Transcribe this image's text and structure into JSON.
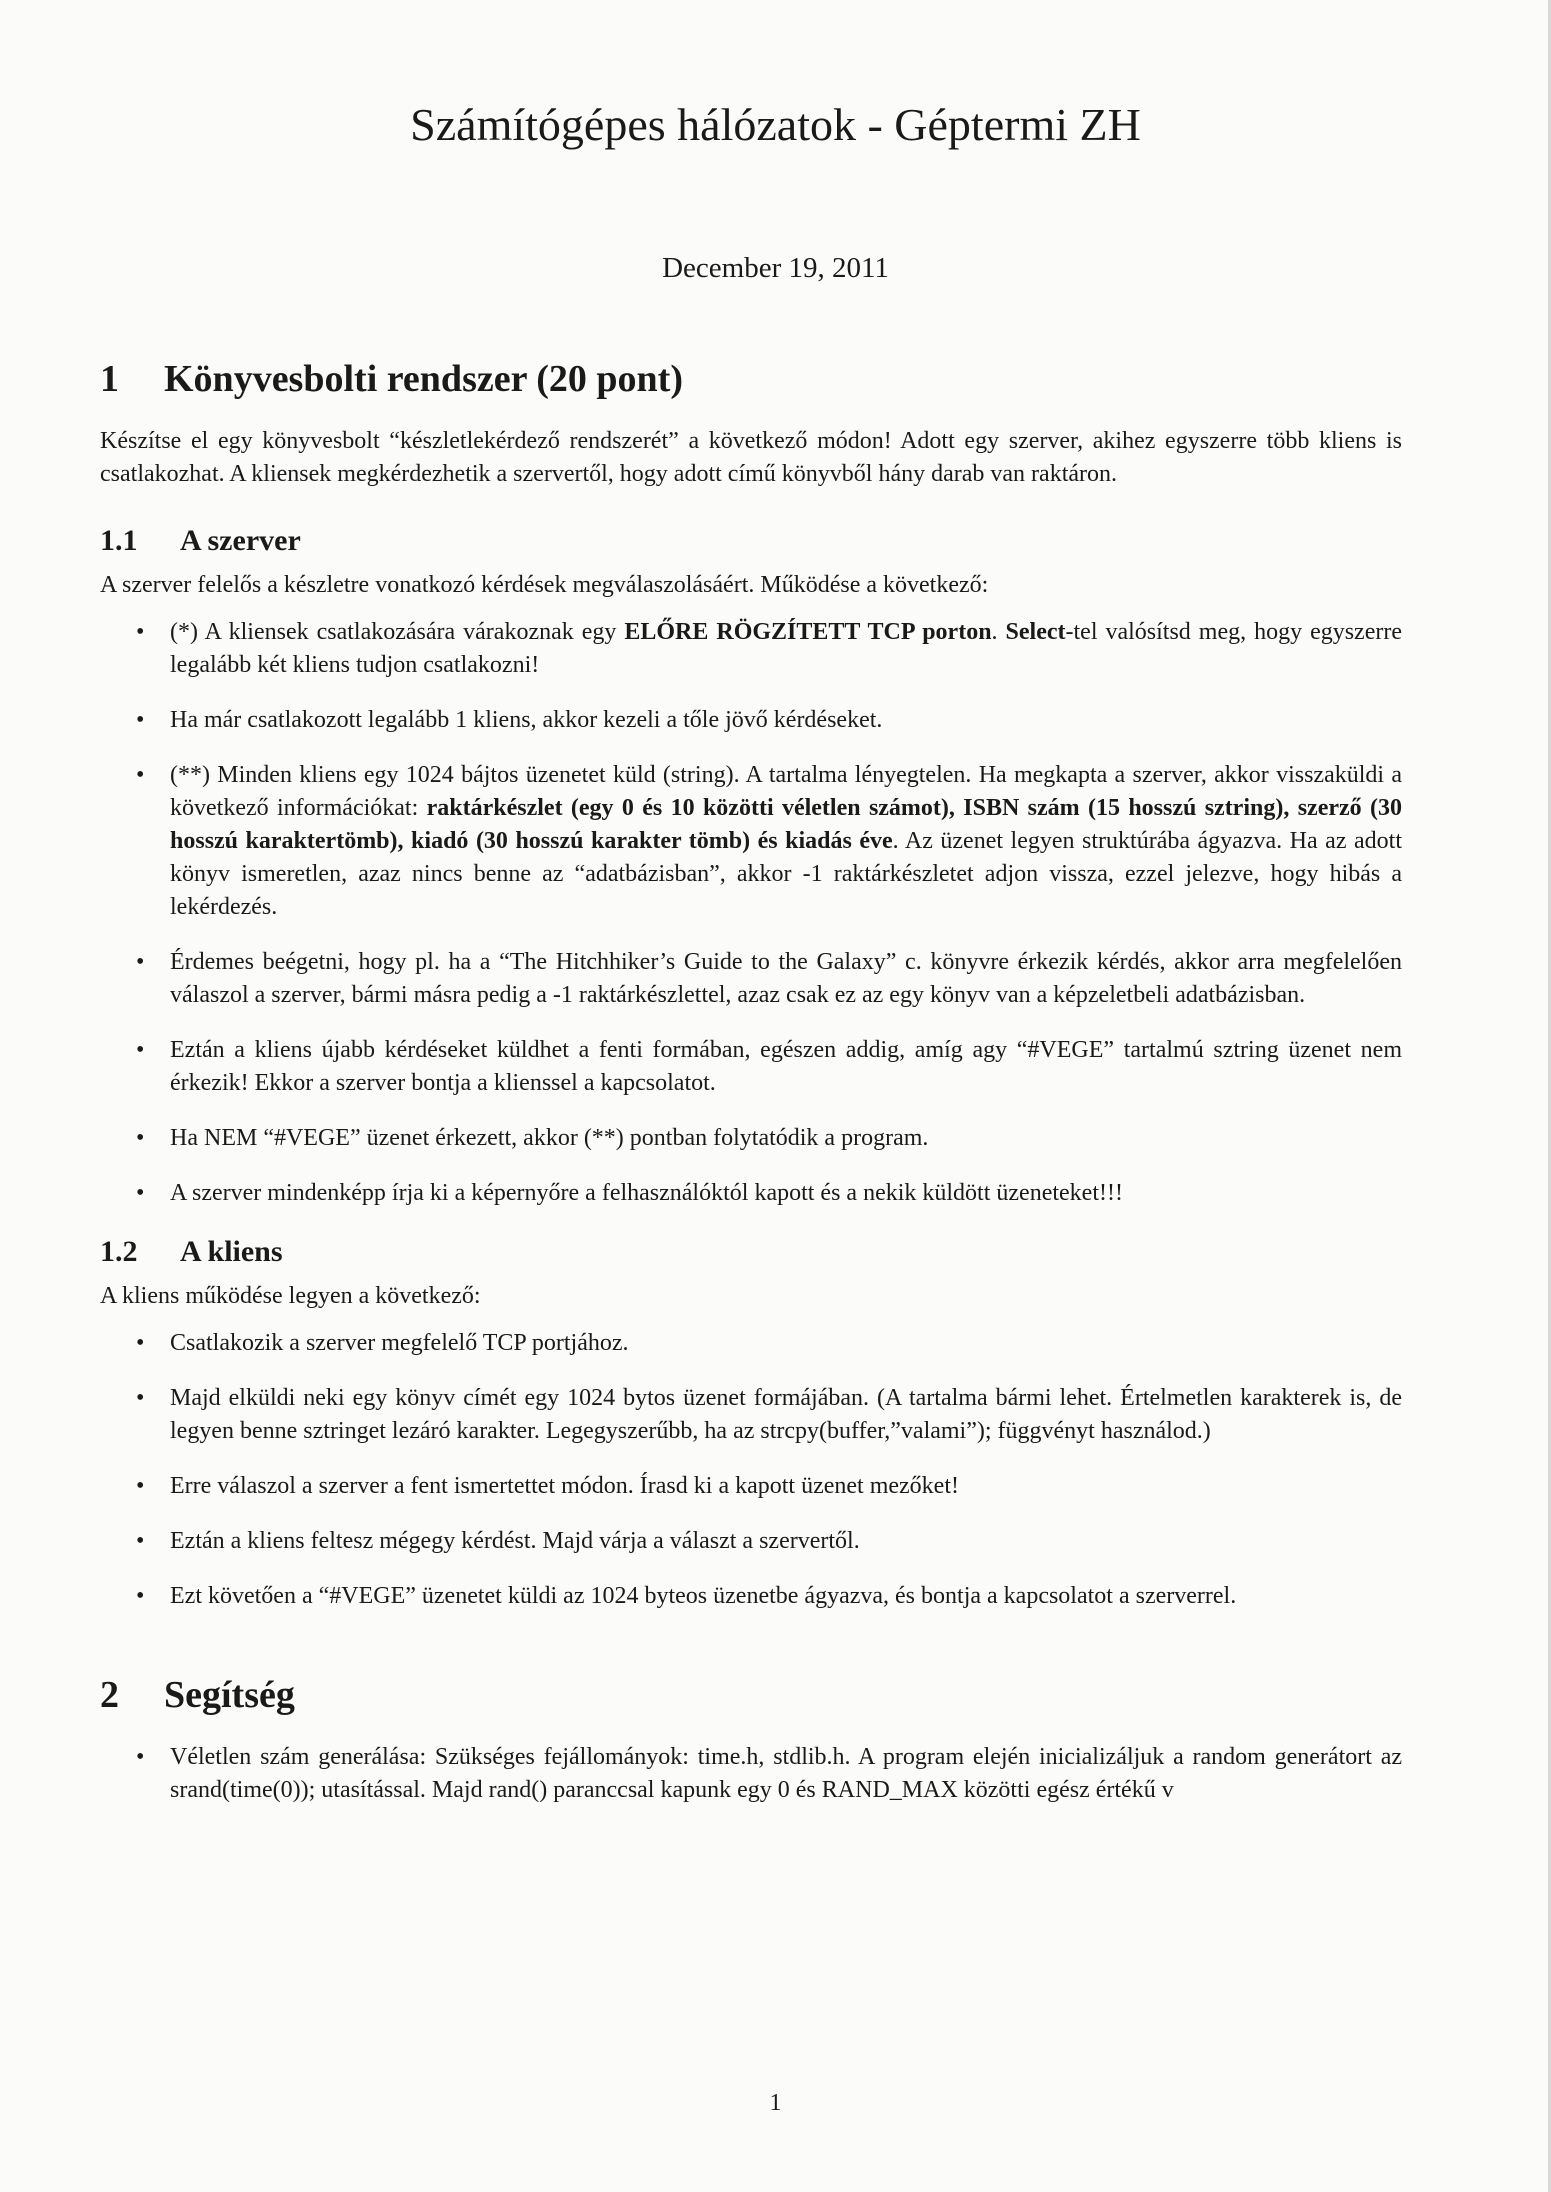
{
  "header": {
    "title": "Számítógépes hálózatok - Géptermi ZH",
    "date": "December 19, 2011"
  },
  "section1": {
    "number": "1",
    "title": "Könyvesbolti rendszer (20 pont)",
    "intro": "Készítse el egy könyvesbolt “készletlekérdező rendszerét” a következő módon! Adott egy szerver, akihez egyszerre több kliens is csatlakozhat. A kliensek megkérdezhetik a szervertől, hogy adott című könyvből hány darab van raktáron."
  },
  "subsection11": {
    "number": "1.1",
    "title": "A szerver",
    "intro": "A szerver felelős a készletre vonatkozó kérdések megválaszolásáért. Működése a következő:",
    "b1_pre": "(*) A kliensek csatlakozására várakoznak egy ",
    "b1_bold1": "ELŐRE RÖGZÍTETT TCP porton",
    "b1_mid": ". ",
    "b1_bold2": "Select",
    "b1_post": "-tel valósítsd meg, hogy egyszerre legalább két kliens tudjon csatlakozni!",
    "b2": "Ha már csatlakozott legalább 1 kliens, akkor kezeli a tőle jövő kérdéseket.",
    "b3_pre": "(**) Minden kliens egy 1024 bájtos üzenetet küld (string). A tartalma lényegtelen. Ha megkapta a szerver, akkor visszaküldi a következő információkat: ",
    "b3_bold": "raktárkészlet (egy 0 és 10 közötti véletlen számot), ISBN szám (15 hosszú sztring), szerző (30 hosszú karaktertömb), kiadó (30 hosszú karakter tömb) és kiadás éve",
    "b3_post": ". Az üzenet legyen struktúrába ágyazva. Ha az adott könyv ismeretlen, azaz nincs benne az “adatbázisban”, akkor -1 raktárkészletet adjon vissza, ezzel jelezve, hogy hibás a lekérdezés.",
    "b4": "Érdemes beégetni, hogy pl. ha a “The Hitchhiker’s Guide to the Galaxy” c. könyvre érkezik kérdés, akkor arra megfelelően válaszol a szerver, bármi másra pedig a -1 raktárkészlettel, azaz csak ez az egy könyv van a képzeletbeli adatbázisban.",
    "b5": "Eztán a kliens újabb kérdéseket küldhet a fenti formában, egészen addig, amíg agy “#VEGE” tartalmú sztring üzenet nem érkezik! Ekkor a szerver bontja a klienssel a kapcsolatot.",
    "b6": "Ha NEM “#VEGE” üzenet érkezett, akkor (**) pontban folytatódik a program.",
    "b7": "A szerver mindenképp írja ki a képernyőre a felhasználóktól kapott és a nekik küldött üzeneteket!!!"
  },
  "subsection12": {
    "number": "1.2",
    "title": "A kliens",
    "intro": "A kliens működése legyen a következő:",
    "b1": "Csatlakozik a szerver megfelelő TCP portjához.",
    "b2": "Majd elküldi neki egy könyv címét egy 1024 bytos üzenet formájában. (A tartalma bármi lehet. Értelmetlen karakterek is, de legyen benne sztringet lezáró karakter. Legegyszerűbb, ha az strcpy(buffer,”valami”); függvényt használod.)",
    "b3": "Erre válaszol a szerver a fent ismertettet módon. Írasd ki a kapott üzenet mezőket!",
    "b4": "Eztán a kliens feltesz mégegy kérdést. Majd várja a választ a szervertől.",
    "b5": "Ezt követően a “#VEGE” üzenetet küldi az 1024 byteos üzenetbe ágyazva, és bontja a kapcsolatot a szerverrel."
  },
  "section2": {
    "number": "2",
    "title": "Segítség",
    "b1": "Véletlen szám generálása: Szükséges fejállományok: time.h, stdlib.h. A program elején inicializáljuk a random generátort az srand(time(0)); utasítással. Majd rand() paranccsal kapunk egy 0 és RAND_MAX közötti egész értékű v"
  },
  "bullet_symbol": "•",
  "footer": {
    "page_number": "1"
  }
}
